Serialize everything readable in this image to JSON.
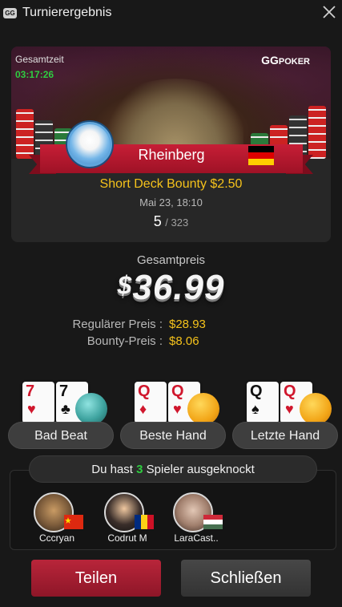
{
  "header": {
    "logo_text": "GG",
    "title": "Turnierergebnis",
    "close_icon": "close-icon"
  },
  "card": {
    "total_time_label": "Gesamtzeit",
    "total_time_value": "03:17:26",
    "brand_logo_mark": "GG",
    "brand_logo_text": "POKER",
    "player_name": "Rheinberg",
    "player_flag": "germany-flag",
    "tournament_name": "Short Deck Bounty $2.50",
    "tournament_date": "Mai 23, 18:10",
    "place": "5",
    "total_entries": "/ 323"
  },
  "prize": {
    "label": "Gesamtpreis",
    "currency": "$",
    "amount": "36.99",
    "regular_label": "Regulärer Preis :",
    "regular_value": "$28.93",
    "bounty_label": "Bounty-Preis :",
    "bounty_value": "$8.06"
  },
  "highlights": [
    {
      "label": "Bad Beat",
      "cards": [
        {
          "rank": "7",
          "suit": "♥",
          "color": "red"
        },
        {
          "rank": "7",
          "suit": "♣",
          "color": "black"
        }
      ]
    },
    {
      "label": "Beste Hand",
      "cards": [
        {
          "rank": "Q",
          "suit": "♦",
          "color": "red"
        },
        {
          "rank": "Q",
          "suit": "♥",
          "color": "red"
        }
      ]
    },
    {
      "label": "Letzte Hand",
      "cards": [
        {
          "rank": "Q",
          "suit": "♠",
          "color": "black"
        },
        {
          "rank": "Q",
          "suit": "♥",
          "color": "red"
        }
      ]
    }
  ],
  "knockouts": {
    "text_before": "Du hast ",
    "count": "3",
    "text_after": " Spieler ausgeknockt",
    "players": [
      {
        "name": "Cccryan",
        "flag": "china-flag"
      },
      {
        "name": "Codrut M",
        "flag": "romania-flag"
      },
      {
        "name": "LaraCast..",
        "flag": "hungary-flag"
      }
    ]
  },
  "buttons": {
    "share": "Teilen",
    "close": "Schließen"
  },
  "colors": {
    "accent_gold": "#f5c21b",
    "timer_green": "#2ecc40",
    "share_red": "#b8253a",
    "ribbon_red": "#c71e36"
  }
}
